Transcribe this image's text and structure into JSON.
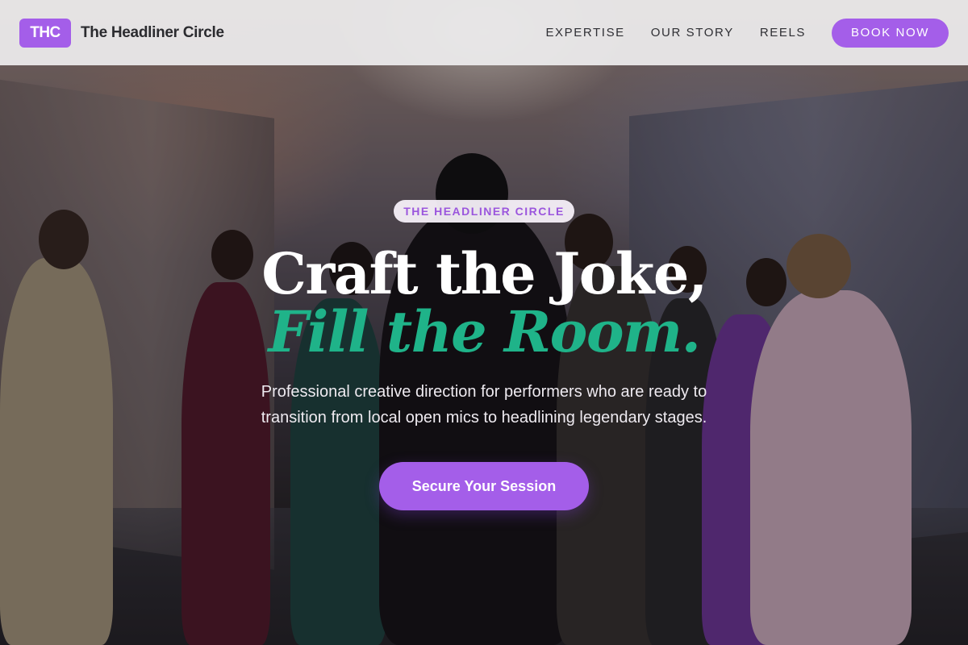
{
  "nav": {
    "logo_text": "THC",
    "brand_name": "The Headliner Circle",
    "links": [
      "EXPERTISE",
      "OUR STORY",
      "REELS"
    ],
    "book_label": "BOOK NOW"
  },
  "hero": {
    "eyebrow": "THE HEADLINER CIRCLE",
    "headline_line1": "Craft the Joke,",
    "headline_line2": "Fill the Room.",
    "subtitle": "Professional creative direction for performers who are ready to transition from local open mics to headlining legendary stages.",
    "cta_label": "Secure Your Session"
  },
  "colors": {
    "accent": "#a45ee9",
    "headline_accent": "#1fb389",
    "nav_background": "#ecebec"
  }
}
